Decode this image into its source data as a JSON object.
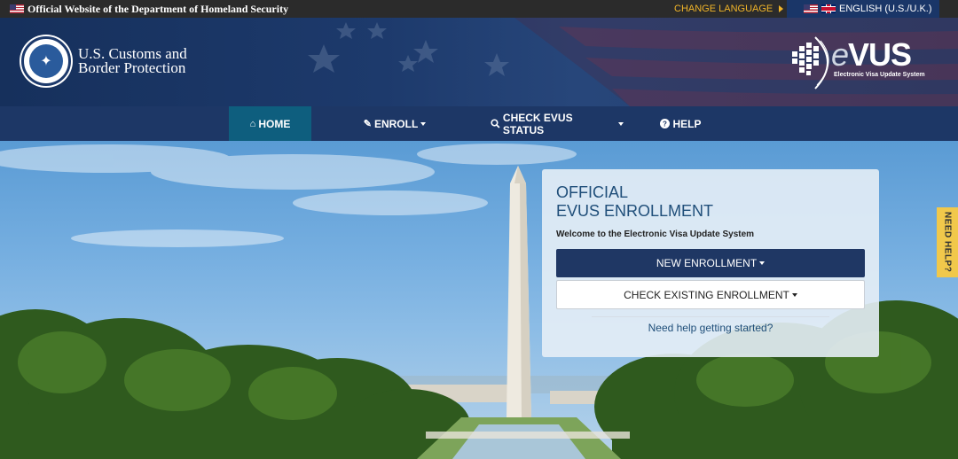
{
  "topbar": {
    "official_text": "Official Website of the Department of Homeland Security",
    "change_language": "CHANGE LANGUAGE",
    "language": "ENGLISH (U.S./U.K.)"
  },
  "header": {
    "agency_line1": "U.S. Customs and",
    "agency_line2": "Border Protection",
    "logo_text_e": "e",
    "logo_text_vus": "VUS",
    "logo_subtitle": "Electronic Visa Update System"
  },
  "nav": {
    "items": [
      {
        "label": "HOME",
        "icon": "home-icon"
      },
      {
        "label": "ENROLL",
        "icon": "pencil-icon"
      },
      {
        "label": "CHECK EVUS STATUS",
        "icon": "search-icon"
      },
      {
        "label": "HELP",
        "icon": "question-icon"
      }
    ]
  },
  "panel": {
    "title_line1": "OFFICIAL",
    "title_line2": "EVUS ENROLLMENT",
    "welcome": "Welcome to the Electronic Visa Update System",
    "new_enrollment": "NEW ENROLLMENT",
    "check_existing": "CHECK EXISTING ENROLLMENT",
    "help_link": "Need help getting started?"
  },
  "need_help_tab": "NEED HELP?",
  "colors": {
    "topbar": "#2b2b2b",
    "navy": "#1f3764",
    "active_nav": "#0e5e7e",
    "accent_gold": "#f0b429",
    "help_tab": "#f1c84b"
  }
}
